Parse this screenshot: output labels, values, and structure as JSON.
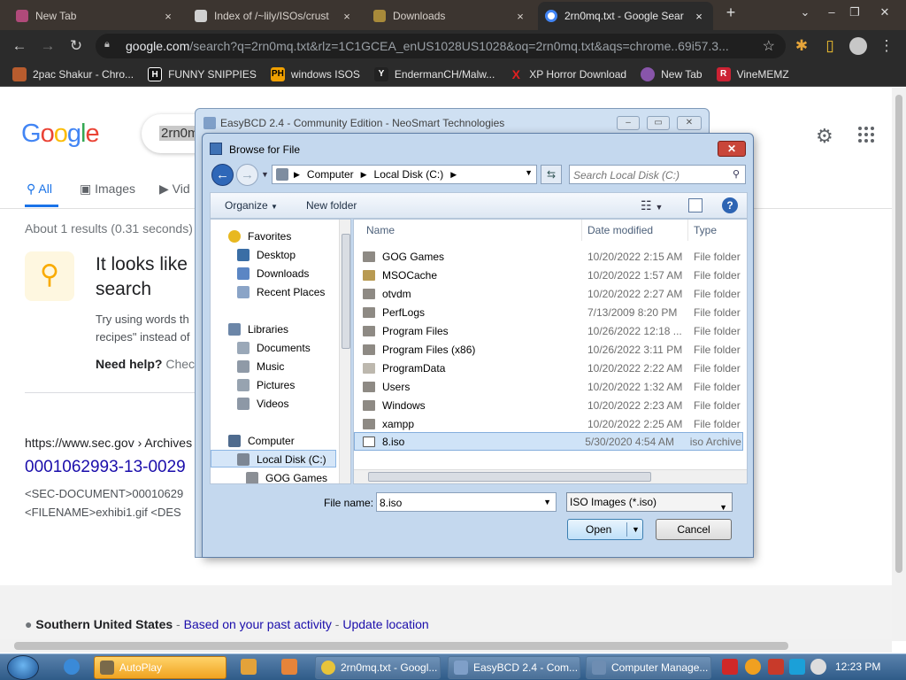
{
  "browser": {
    "tabs": [
      {
        "label": "New Tab",
        "close": "×",
        "active": false
      },
      {
        "label": "Index of /~lily/ISOs/crust",
        "close": "×",
        "active": false
      },
      {
        "label": "Downloads",
        "close": "×",
        "active": false
      },
      {
        "label": "2rn0mq.txt - Google Sear",
        "close": "×",
        "active": true
      }
    ],
    "new_tab": "+",
    "window_controls": [
      "⌄",
      "–",
      "❐",
      "✕"
    ],
    "url_domain": "google.com",
    "url_rest": "/search?q=2rn0mq.txt&rlz=1C1GCEA_enUS1028US1028&oq=2rn0mq.txt&aqs=chrome..69i57.3...",
    "bookmarks": [
      {
        "label": "2pac Shakur - Chro...",
        "icon_text": "",
        "color": "#b85c2e"
      },
      {
        "label": "FUNNY SNIPPIES",
        "icon_text": "H",
        "color": "#111111"
      },
      {
        "label": "windows ISOS",
        "icon_text": "PH",
        "color": "#f0a000"
      },
      {
        "label": "EndermanCH/Malw...",
        "icon_text": "Y",
        "color": "#222222"
      },
      {
        "label": "XP Horror Download",
        "icon_text": "X",
        "color": "#cc1111"
      },
      {
        "label": "New Tab",
        "icon_text": "",
        "color": "#8855aa"
      },
      {
        "label": "VineMEMZ",
        "icon_text": "R",
        "color": "#cc2233"
      }
    ]
  },
  "google": {
    "query_fragment": "2rn0m",
    "tabs": {
      "all": "All",
      "images": "Images",
      "videos": "Vid"
    },
    "stats": "About 1 results (0.31 seconds)",
    "suggestion_title": "It looks like search",
    "suggestion_title_lines": [
      "It looks like",
      "search"
    ],
    "suggestion_body": [
      "Try using words th",
      "recipes\" instead of"
    ],
    "need_help_bold": "Need help?",
    "need_help_rest": " Chec",
    "result_url": "https://www.sec.gov › Archives",
    "result_title": "0001062993-13-0029",
    "result_snippet": [
      "<SEC-DOCUMENT>00010629",
      "<FILENAME>exhibi1.gif <DES"
    ],
    "footer_region": "Southern United States",
    "footer_sep": " - ",
    "footer_activity": "Based on your past activity",
    "footer_update": "Update location"
  },
  "easybcd": {
    "title": "EasyBCD 2.4 - Community Edition - NeoSmart Technologies"
  },
  "browse": {
    "title": "Browse for File",
    "path": [
      "Computer",
      "Local Disk (C:)"
    ],
    "search_placeholder": "Search Local Disk (C:)",
    "organize": "Organize",
    "new_folder": "New folder",
    "nav": {
      "favorites": "Favorites",
      "desktop": "Desktop",
      "downloads": "Downloads",
      "recent": "Recent Places",
      "libraries": "Libraries",
      "documents": "Documents",
      "music": "Music",
      "pictures": "Pictures",
      "videos": "Videos",
      "computer": "Computer",
      "local_disk": "Local Disk (C:)",
      "gog": "GOG Games"
    },
    "columns": {
      "name": "Name",
      "date": "Date modified",
      "type": "Type"
    },
    "files": [
      {
        "name": "GOG Games",
        "date": "10/20/2022 2:15 AM",
        "type": "File folder"
      },
      {
        "name": "MSOCache",
        "date": "10/20/2022 1:57 AM",
        "type": "File folder"
      },
      {
        "name": "otvdm",
        "date": "10/20/2022 2:27 AM",
        "type": "File folder"
      },
      {
        "name": "PerfLogs",
        "date": "7/13/2009 8:20 PM",
        "type": "File folder"
      },
      {
        "name": "Program Files",
        "date": "10/26/2022 12:18 ...",
        "type": "File folder"
      },
      {
        "name": "Program Files (x86)",
        "date": "10/26/2022 3:11 PM",
        "type": "File folder"
      },
      {
        "name": "ProgramData",
        "date": "10/20/2022 2:22 AM",
        "type": "File folder"
      },
      {
        "name": "Users",
        "date": "10/20/2022 1:32 AM",
        "type": "File folder"
      },
      {
        "name": "Windows",
        "date": "10/20/2022 2:23 AM",
        "type": "File folder"
      },
      {
        "name": "xampp",
        "date": "10/20/2022 2:25 AM",
        "type": "File folder"
      },
      {
        "name": "8.iso",
        "date": "5/30/2020 4:54 AM",
        "type": "iso Archive"
      }
    ],
    "filename_label": "File name:",
    "filename_value": "8.iso",
    "filetype": "ISO Images (*.iso)",
    "open": "Open",
    "cancel": "Cancel"
  },
  "taskbar": {
    "items": [
      {
        "label": "AutoPlay"
      },
      {
        "label": "2rn0mq.txt - Googl..."
      },
      {
        "label": "EasyBCD 2.4 - Com..."
      },
      {
        "label": "Computer Manage..."
      }
    ],
    "clock": "12:23 PM"
  }
}
